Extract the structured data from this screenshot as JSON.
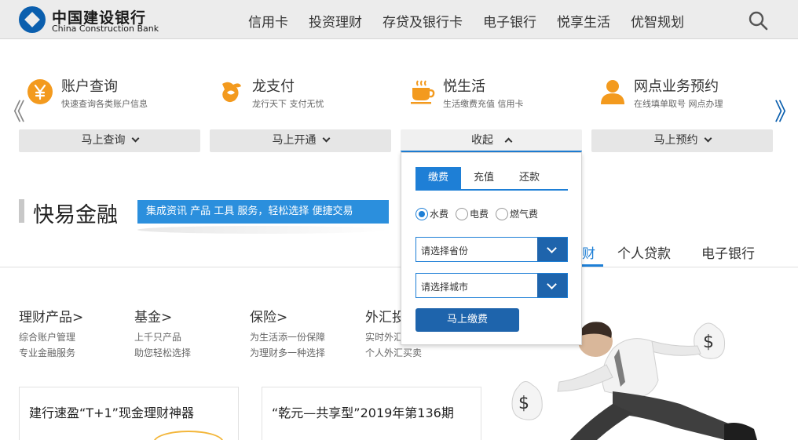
{
  "brand": {
    "name_cn": "中国建设银行",
    "name_en": "China Construction Bank"
  },
  "nav": [
    "信用卡",
    "投资理财",
    "存贷及银行卡",
    "电子银行",
    "悦享生活",
    "优智规划"
  ],
  "services": [
    {
      "title": "账户查询",
      "desc": "快速查询各类账户信息",
      "button": "马上查询"
    },
    {
      "title": "龙支付",
      "desc": "龙行天下 支付无忧",
      "button": "马上开通"
    },
    {
      "title": "悦生活",
      "desc": "生活缴费充值 信用卡",
      "button": "收起"
    },
    {
      "title": "网点业务预约",
      "desc": "在线填单取号 网点办理",
      "button": "马上预约"
    }
  ],
  "arrows": {
    "left": "《",
    "right": "》"
  },
  "panel": {
    "tabs": [
      "缴费",
      "充值",
      "还款"
    ],
    "radios": [
      "水费",
      "电费",
      "燃气费"
    ],
    "province_placeholder": "请选择省份",
    "city_placeholder": "请选择城市",
    "submit": "马上缴费"
  },
  "quick_finance": {
    "title": "快易金融",
    "banner": "集成资讯 产品 工具 服务，轻松选择 便捷交易"
  },
  "tabs": {
    "active_fragment": "财",
    "items": [
      "个人贷款",
      "电子银行"
    ]
  },
  "products": [
    {
      "title": "理财产品>",
      "lines": [
        "综合账户管理",
        "专业金融服务"
      ]
    },
    {
      "title": "基金>",
      "lines": [
        "上千只产品",
        "助您轻松选择"
      ]
    },
    {
      "title": "保险>",
      "lines": [
        "为生活添一份保障",
        "为理财多一种选择"
      ]
    },
    {
      "title": "外汇投",
      "lines": [
        "实时外汇",
        "个人外汇买卖"
      ]
    }
  ],
  "cards": [
    "建行速盈“T+1”现金理财神器",
    "“乾元—共享型”2019年第136期"
  ],
  "colors": {
    "accent": "#1e7fd6",
    "dark_blue": "#1e64ac",
    "banner": "#2b8fdd",
    "orange": "#f39a1e"
  }
}
